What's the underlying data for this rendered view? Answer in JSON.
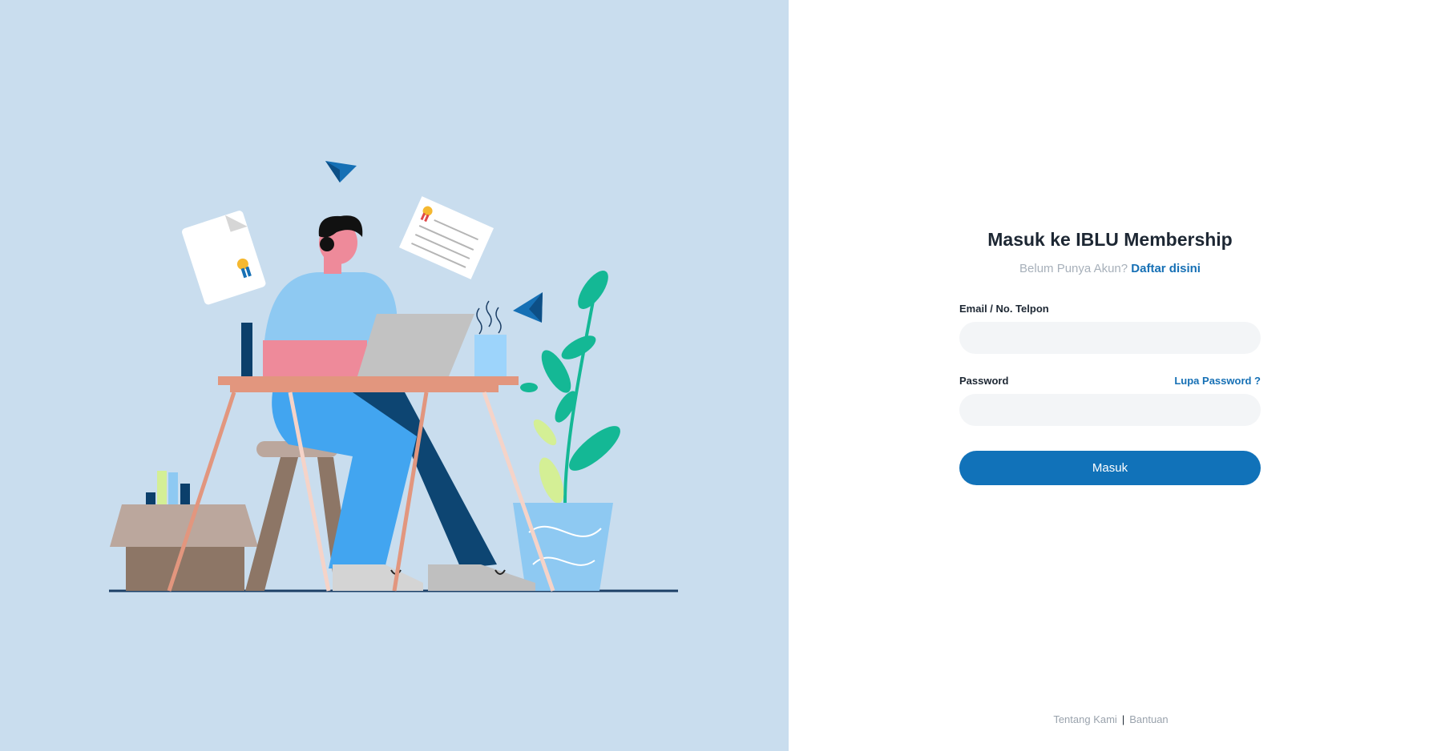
{
  "login": {
    "title": "Masuk ke IBLU Membership",
    "signup_prompt": "Belum Punya Akun?",
    "signup_link": "Daftar disini",
    "email_label": "Email / No. Telpon",
    "email_value": "",
    "password_label": "Password",
    "password_value": "",
    "forgot_password": "Lupa Password ?",
    "submit_label": "Masuk"
  },
  "footer": {
    "about": "Tentang Kami",
    "separator": "|",
    "help": "Bantuan"
  },
  "colors": {
    "left_panel_bg": "#c9ddee",
    "accent": "#1172b9",
    "link": "#1670b5",
    "input_bg": "#f3f5f7"
  },
  "icons": [
    "paper-plane-icon",
    "certificate-icon",
    "document-icon"
  ]
}
